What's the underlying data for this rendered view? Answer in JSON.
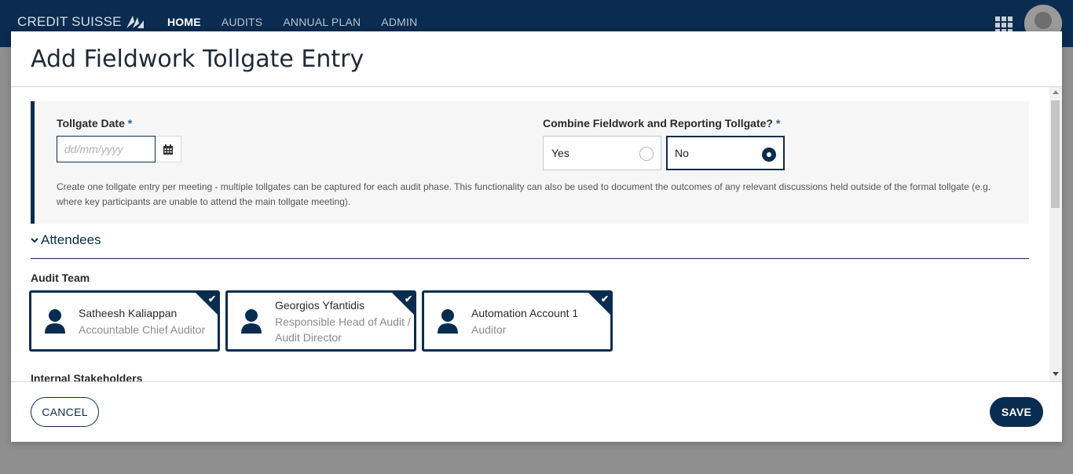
{
  "brand": {
    "name": "CREDIT SUISSE"
  },
  "nav": {
    "items": [
      {
        "label": "HOME",
        "active": true
      },
      {
        "label": "AUDITS",
        "active": false
      },
      {
        "label": "ANNUAL PLAN",
        "active": false
      },
      {
        "label": "ADMIN",
        "active": false
      }
    ],
    "apps_icon": "apps-grid-icon",
    "avatar_icon": "user-avatar-icon"
  },
  "modal": {
    "title": "Add Fieldwork Tollgate Entry",
    "tollgate_date": {
      "label": "Tollgate Date",
      "required_mark": "*",
      "placeholder": "dd/mm/yyyy",
      "value": ""
    },
    "combine": {
      "label": "Combine Fieldwork and Reporting Tollgate?",
      "required_mark": "*",
      "options": [
        {
          "label": "Yes",
          "selected": false
        },
        {
          "label": "No",
          "selected": true
        }
      ]
    },
    "help_text": "Create one tollgate entry per meeting - multiple tollgates can be captured  for each audit phase.  This functionality can also be used to document the outcomes of any relevant discussions held outside of the formal tollgate (e.g. where key participants are unable to attend the main tollgate meeting).",
    "attendees": {
      "title": "Attendees",
      "audit_team_label": "Audit Team",
      "audit_team": [
        {
          "name": "Satheesh Kaliappan",
          "role": "Accountable Chief Auditor",
          "selected": true
        },
        {
          "name": "Georgios Yfantidis",
          "role": "Responsible Head of Audit / Audit Director",
          "selected": true
        },
        {
          "name": "Automation Account 1",
          "role": "Auditor",
          "selected": true
        }
      ],
      "internal_stakeholders_label": "Internal Stakeholders"
    },
    "footer": {
      "cancel_label": "CANCEL",
      "save_label": "SAVE"
    }
  },
  "colors": {
    "navy": "#0a2c50",
    "overlay": "#8f8f8f",
    "panel_bg": "#f6f6f6",
    "required": "#1e5aa8"
  }
}
